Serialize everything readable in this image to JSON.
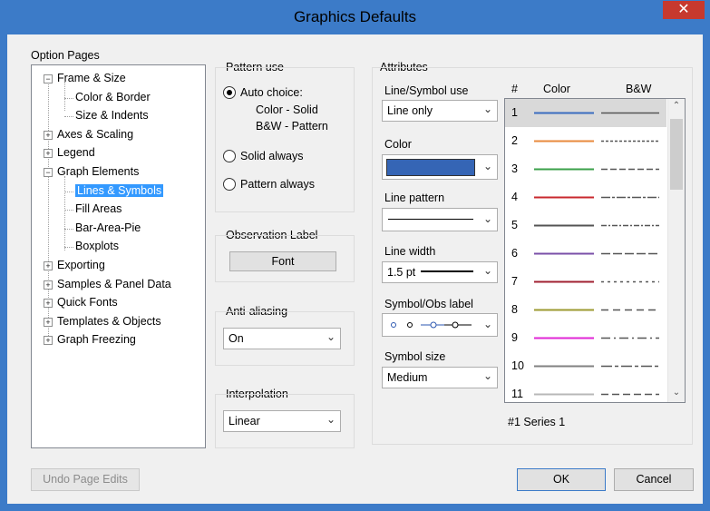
{
  "window": {
    "title": "Graphics Defaults",
    "close": "✕"
  },
  "option_pages": {
    "heading": "Option Pages",
    "items": [
      {
        "label": "Frame & Size",
        "expander": "−"
      },
      {
        "label": "Color & Border"
      },
      {
        "label": "Size & Indents"
      },
      {
        "label": "Axes & Scaling",
        "expander": "+"
      },
      {
        "label": "Legend",
        "expander": "+"
      },
      {
        "label": "Graph Elements",
        "expander": "−"
      },
      {
        "label": "Lines & Symbols",
        "selected": true
      },
      {
        "label": "Fill Areas"
      },
      {
        "label": "Bar-Area-Pie"
      },
      {
        "label": "Boxplots"
      },
      {
        "label": "Exporting",
        "expander": "+"
      },
      {
        "label": "Samples & Panel Data",
        "expander": "+"
      },
      {
        "label": "Quick Fonts",
        "expander": "+"
      },
      {
        "label": "Templates & Objects",
        "expander": "+"
      },
      {
        "label": "Graph Freezing",
        "expander": "+"
      }
    ]
  },
  "pattern_use": {
    "heading": "Pattern use",
    "auto_choice": "Auto choice:",
    "auto_note1": "Color - Solid",
    "auto_note2": "B&W - Pattern",
    "solid_always": "Solid always",
    "pattern_always": "Pattern always",
    "selected": "Auto choice:"
  },
  "observation_label": {
    "heading": "Observation Label",
    "font_button": "Font"
  },
  "anti_aliasing": {
    "heading": "Anti-aliasing",
    "value": "On"
  },
  "interpolation": {
    "heading": "Interpolation",
    "value": "Linear"
  },
  "attributes": {
    "heading": "Attributes",
    "line_symbol_use": {
      "label": "Line/Symbol use",
      "value": "Line only"
    },
    "color": {
      "label": "Color",
      "value": "#3565b5"
    },
    "line_pattern": {
      "label": "Line pattern"
    },
    "line_width": {
      "label": "Line width",
      "value": "1.5 pt"
    },
    "symbol_label": {
      "label": "Symbol/Obs label"
    },
    "symbol_size": {
      "label": "Symbol size",
      "value": "Medium"
    },
    "series_caption": "#1  Series 1"
  },
  "series_list": {
    "col_num": "#",
    "col_color": "Color",
    "col_bw": "B&W",
    "rows": [
      {
        "num": "1",
        "color": "#3a6cc0",
        "dash": "none"
      },
      {
        "num": "2",
        "color": "#e88a3c",
        "dash": "3,2"
      },
      {
        "num": "3",
        "color": "#3aa04a",
        "dash": "7,3"
      },
      {
        "num": "4",
        "color": "#c8282e",
        "dash": "10,2,3,2"
      },
      {
        "num": "5",
        "color": "#555555",
        "dash": "6,2,2,2"
      },
      {
        "num": "6",
        "color": "#7a4fa8",
        "dash": "10,3"
      },
      {
        "num": "7",
        "color": "#a02030",
        "dash": "3,4"
      },
      {
        "num": "8",
        "color": "#9c9a30",
        "dash": "8,5"
      },
      {
        "num": "9",
        "color": "#e025d5",
        "dash": "10,4,2,4"
      },
      {
        "num": "10",
        "color": "#808080",
        "dash": "12,3,4,3"
      },
      {
        "num": "11",
        "color": "#b8b8b8",
        "dash": "8,4"
      }
    ]
  },
  "buttons": {
    "undo": "Undo Page Edits",
    "ok": "OK",
    "cancel": "Cancel"
  }
}
